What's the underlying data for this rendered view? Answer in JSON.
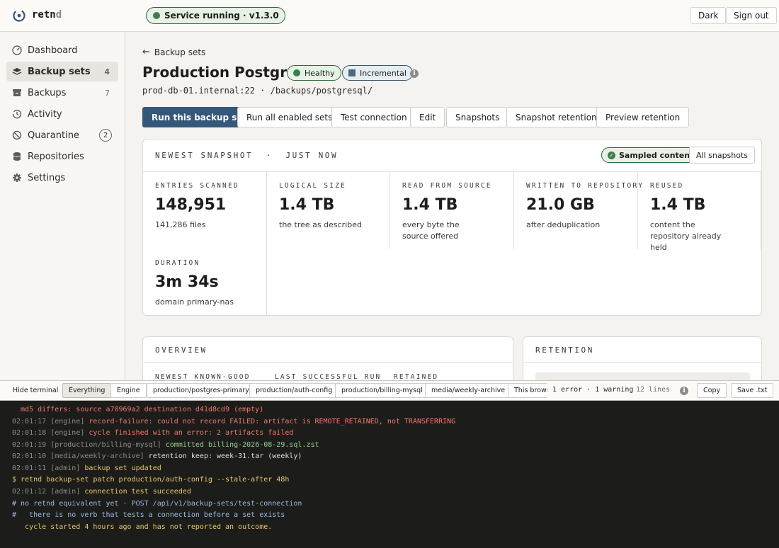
{
  "app": {
    "brand_main": "retn",
    "brand_dim": "d",
    "service_status": "Service running · v1.3.0"
  },
  "topbar": {
    "theme_label": "Dark",
    "signout_label": "Sign out"
  },
  "sidebar": {
    "items": [
      {
        "label": "Dashboard",
        "count": ""
      },
      {
        "label": "Backup sets",
        "count": "4"
      },
      {
        "label": "Backups",
        "count": "7"
      },
      {
        "label": "Activity",
        "count": ""
      },
      {
        "label": "Quarantine",
        "count": "2"
      },
      {
        "label": "Repositories",
        "count": ""
      },
      {
        "label": "Settings",
        "count": ""
      }
    ]
  },
  "main": {
    "back_label": "Backup sets",
    "title": "Production PostgreSQL",
    "badge_health": "Healthy",
    "badge_mode": "Incremental",
    "path": "prod-db-01.internal:22  ·  /backups/postgresql/",
    "actions": [
      "Run this backup set",
      "Run all enabled sets",
      "Test connection",
      "Edit",
      "Snapshots",
      "Snapshot retention",
      "Preview retention"
    ]
  },
  "snapshot": {
    "heading": "Newest snapshot  ·  just now",
    "sampled_label": "Sampled content",
    "all_snapshots_label": "All snapshots",
    "metrics": [
      {
        "label": "Entries scanned",
        "value": "148,951",
        "sub": "141,286 files"
      },
      {
        "label": "Logical size",
        "value": "1.4 TB",
        "sub": "the tree as described"
      },
      {
        "label": "Read from source",
        "value": "1.4 TB",
        "sub": "every byte the source offered"
      },
      {
        "label": "Written to repository",
        "value": "21.0 GB",
        "sub": "after deduplication"
      },
      {
        "label": "Reused",
        "value": "1.4 TB",
        "sub": "content the repository already held"
      },
      {
        "label": "Duration",
        "value": "3m 34s",
        "sub": "domain primary-nas"
      }
    ]
  },
  "overview": {
    "heading": "Overview",
    "cols": [
      "Newest known-good",
      "Last successful run",
      "Retained"
    ]
  },
  "retention": {
    "heading": "Retention"
  },
  "terminal_bar": {
    "hide_label": "Hide terminal",
    "filters": [
      "Everything",
      "Engine",
      "production/postgres-primary",
      "production/auth-config",
      "production/billing-mysql",
      "media/weekly-archive",
      "This browse"
    ],
    "errors": "1 error · 1 warning",
    "lines": "12 lines",
    "copy_label": "Copy",
    "save_label": "Save .txt"
  },
  "terminal": {
    "lines": [
      {
        "ts": "",
        "tag": "",
        "msg": "  md5 differs: source a70969a2 destination d41d8cd9 (empty)"
      },
      {
        "ts": "02:01:17",
        "tag": "[engine]",
        "msg": " record-failure: could not record FAILED: artifact is REMOTE_RETAINED, not TRANSFERRING"
      },
      {
        "ts": "02:01:18",
        "tag": "[engine]",
        "msg": " cycle finished with an error: 2 artifacts failed"
      },
      {
        "ts": "02:01:19",
        "tag": "[production/billing-mysql]",
        "msg": " committed billing-2026-08-29.sql.zst"
      },
      {
        "ts": "02:01:10",
        "tag": "[media/weekly-archive]",
        "msg": " retention keep: week-31.tar (weekly)"
      },
      {
        "ts": "02:01:11",
        "tag": "[admin]",
        "msg": " backup set updated"
      },
      {
        "ts": "",
        "tag": "",
        "msg": "$ retnd backup-set patch production/auth-config --stale-after 48h"
      },
      {
        "ts": "02:01:12",
        "tag": "[admin]",
        "msg": " connection test succeeded"
      },
      {
        "ts": "",
        "tag": "",
        "msg": "# no retnd equivalent yet · POST /api/v1/backup-sets/test-connection"
      },
      {
        "ts": "",
        "tag": "",
        "msg": "#   there is no verb that tests a connection before a set exists"
      },
      {
        "ts": "",
        "tag": "",
        "msg": "   cycle started 4 hours ago and has not reported an outcome."
      }
    ]
  }
}
